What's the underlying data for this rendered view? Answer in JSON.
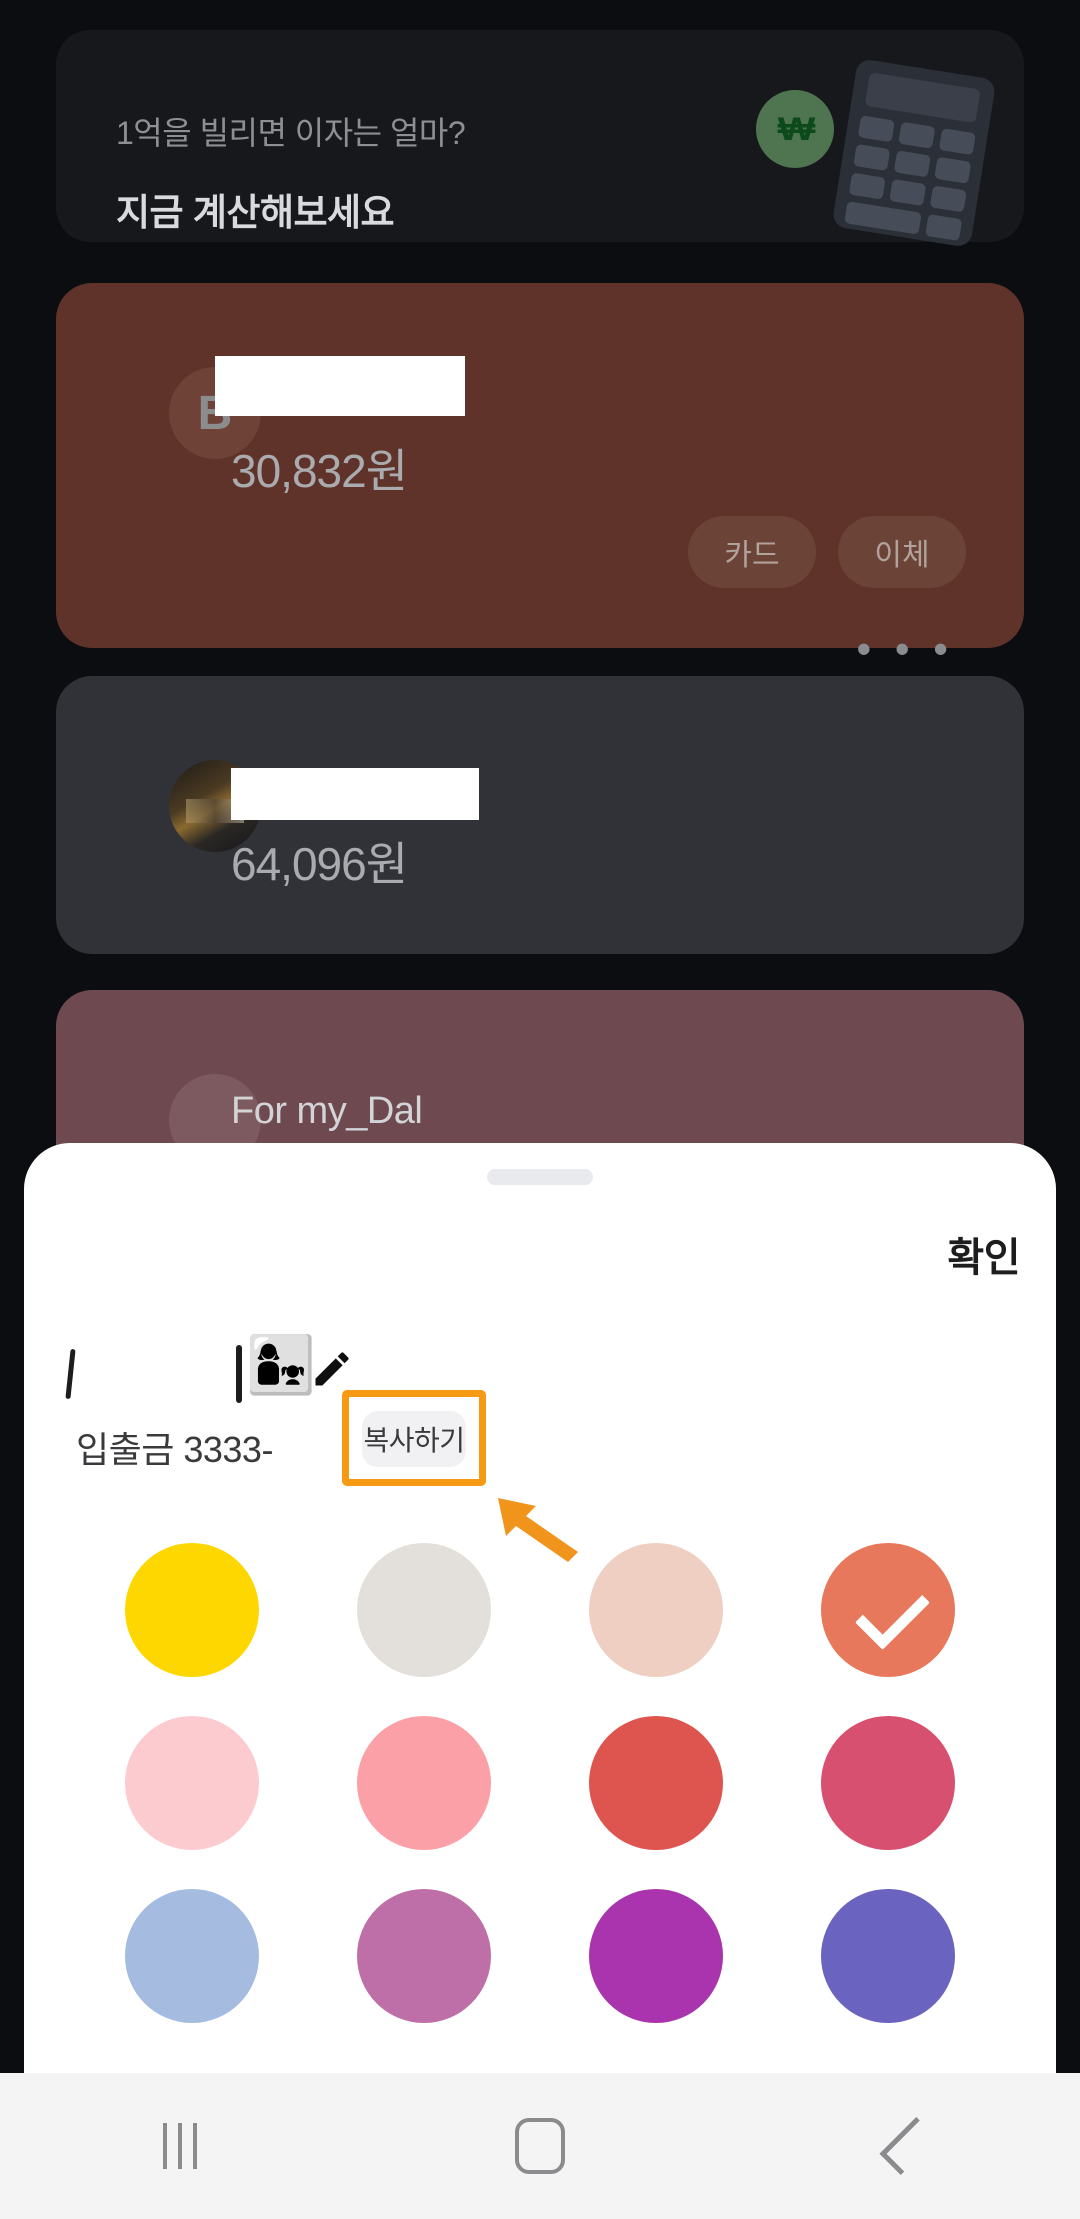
{
  "promo": {
    "subtitle": "1억을 빌리면 이자는 얼마?",
    "title": "지금 계산해보세요",
    "logo_glyph": "₩",
    "logo_color": "#4e7450",
    "calculator_icon": "calculator-illustration"
  },
  "accounts": [
    {
      "avatar_letter": "B",
      "balance": "30,832원",
      "more_label": "• • •",
      "card_color": "#5f3329",
      "actions": [
        {
          "label": "카드"
        },
        {
          "label": "이체"
        }
      ]
    },
    {
      "avatar_letter": "",
      "balance": "64,096원",
      "more_label": "• • •",
      "card_color": "#303237"
    },
    {
      "avatar_letter": "",
      "name": "For my_Dal",
      "more_label": "• • •",
      "card_color": "#6e4a50"
    }
  ],
  "sheet": {
    "confirm_label": "확인",
    "nickname_emoji": "👩‍👧",
    "edit_icon": "pencil-icon",
    "account_number": "입출금 3333-",
    "copy_button_label": "복사하기",
    "highlight_color": "#F59A12",
    "arrow_color": "#F0941B",
    "selected_color_index": 3,
    "colors": [
      {
        "name": "yellow",
        "hex": "#FFD700"
      },
      {
        "name": "light-gray",
        "hex": "#E3E0DB"
      },
      {
        "name": "blush-beige",
        "hex": "#EFCFC2"
      },
      {
        "name": "coral",
        "hex": "#E8785C"
      },
      {
        "name": "light-pink",
        "hex": "#FBCBD0"
      },
      {
        "name": "pink",
        "hex": "#FCA0A8"
      },
      {
        "name": "red",
        "hex": "#DE554F"
      },
      {
        "name": "deep-pink",
        "hex": "#D8506F"
      },
      {
        "name": "light-blue",
        "hex": "#A5BBE0"
      },
      {
        "name": "mauve",
        "hex": "#BE6FA8"
      },
      {
        "name": "purple",
        "hex": "#AA34AE"
      },
      {
        "name": "indigo",
        "hex": "#6A63C0"
      }
    ]
  },
  "navbar": {
    "recents_label": "recents-icon",
    "home_label": "home-icon",
    "back_label": "back-icon"
  }
}
